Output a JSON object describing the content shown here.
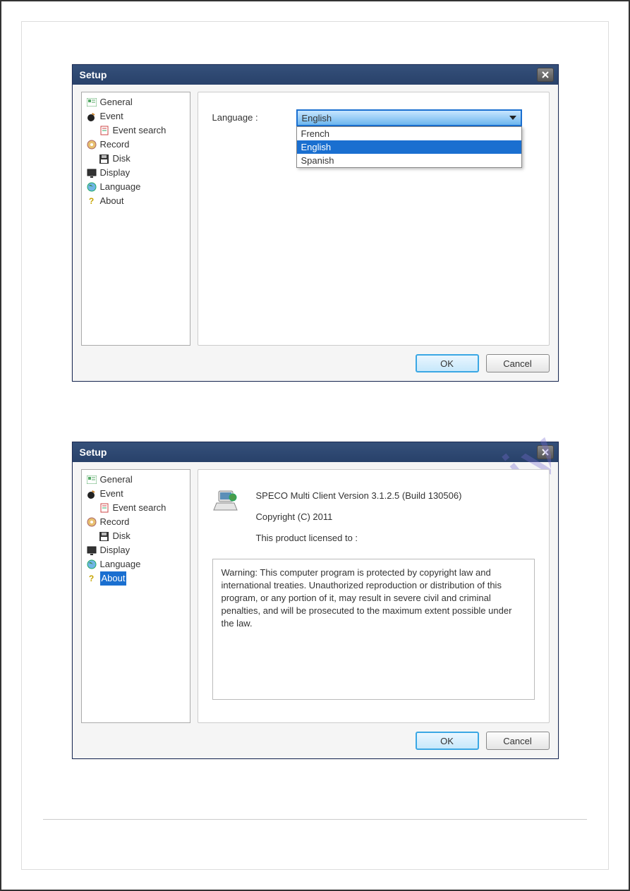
{
  "watermark": "manualshive.com",
  "dialog1": {
    "title": "Setup",
    "tree": {
      "general": "General",
      "event": "Event",
      "event_search": "Event search",
      "record": "Record",
      "disk": "Disk",
      "display": "Display",
      "language": "Language",
      "about": "About"
    },
    "language_label": "Language :",
    "combo_selected": "English",
    "options": {
      "o0": "French",
      "o1": "English",
      "o2": "Spanish"
    },
    "buttons": {
      "ok": "OK",
      "cancel": "Cancel"
    }
  },
  "dialog2": {
    "title": "Setup",
    "tree": {
      "general": "General",
      "event": "Event",
      "event_search": "Event search",
      "record": "Record",
      "disk": "Disk",
      "display": "Display",
      "language": "Language",
      "about": "About"
    },
    "about": {
      "version": "SPECO Multi Client Version 3.1.2.5 (Build 130506)",
      "copyright": "Copyright (C) 2011",
      "licensed_to": "This product licensed to :",
      "warning": "Warning: This computer program is protected by copyright law and international treaties. Unauthorized reproduction or distribution of this program, or any portion of it, may result in severe civil and criminal penalties, and will be prosecuted to the maximum extent possible under the law."
    },
    "buttons": {
      "ok": "OK",
      "cancel": "Cancel"
    }
  }
}
